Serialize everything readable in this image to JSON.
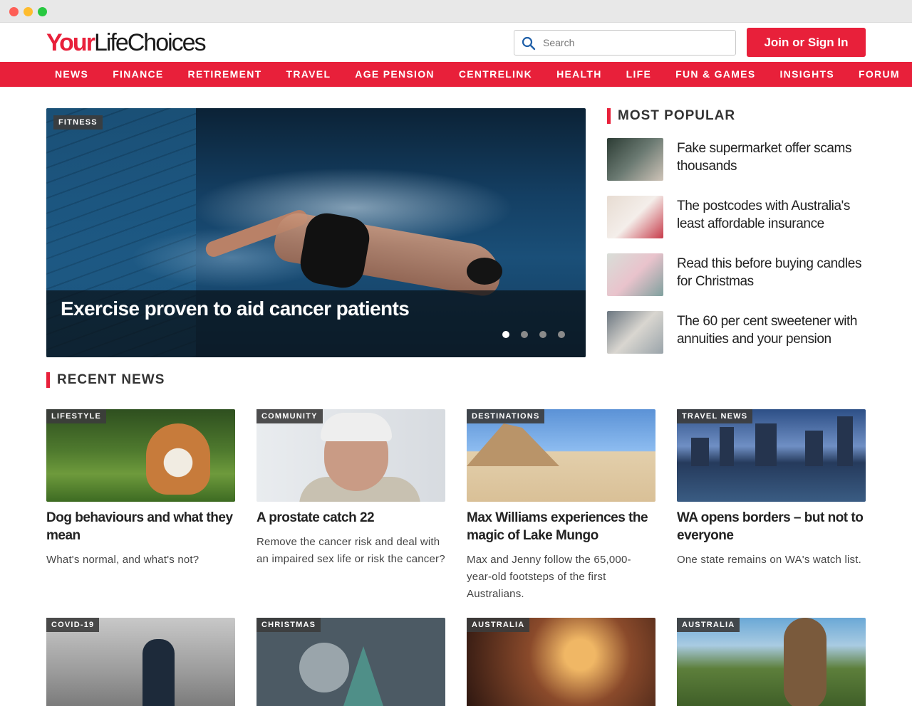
{
  "header": {
    "logo_part1": "Your",
    "logo_part2": "LifeChoices",
    "search_placeholder": "Search",
    "join_label": "Join or Sign In"
  },
  "nav": {
    "items": [
      "NEWS",
      "FINANCE",
      "RETIREMENT",
      "TRAVEL",
      "AGE PENSION",
      "CENTRELINK",
      "HEALTH",
      "LIFE",
      "FUN & GAMES",
      "INSIGHTS",
      "FORUM"
    ]
  },
  "hero": {
    "tag": "FITNESS",
    "title": "Exercise proven to aid cancer patients",
    "slide_count": 4,
    "active_slide": 1
  },
  "popular": {
    "heading": "MOST POPULAR",
    "items": [
      {
        "title": "Fake supermarket offer scams thousands"
      },
      {
        "title": "The postcodes with Australia's least affordable insurance"
      },
      {
        "title": "Read this before buying candles for Christmas"
      },
      {
        "title": "The 60 per cent sweetener with annuities and your pension"
      }
    ]
  },
  "recent": {
    "heading": "RECENT NEWS",
    "cards": [
      {
        "tag": "LIFESTYLE",
        "title": "Dog behaviours and what they mean",
        "desc": "What's normal, and what's not?"
      },
      {
        "tag": "COMMUNITY",
        "title": "A prostate catch 22",
        "desc": "Remove the cancer risk and deal with an impaired sex life or risk the cancer?"
      },
      {
        "tag": "DESTINATIONS",
        "title": "Max Williams experiences the magic of Lake Mungo",
        "desc": "Max and Jenny follow the 65,000-year-old footsteps of the first Australians."
      },
      {
        "tag": "TRAVEL NEWS",
        "title": "WA opens borders – but not to everyone",
        "desc": "One state remains on WA's watch list."
      },
      {
        "tag": "COVID-19"
      },
      {
        "tag": "CHRISTMAS"
      },
      {
        "tag": "AUSTRALIA"
      },
      {
        "tag": "AUSTRALIA"
      }
    ]
  }
}
